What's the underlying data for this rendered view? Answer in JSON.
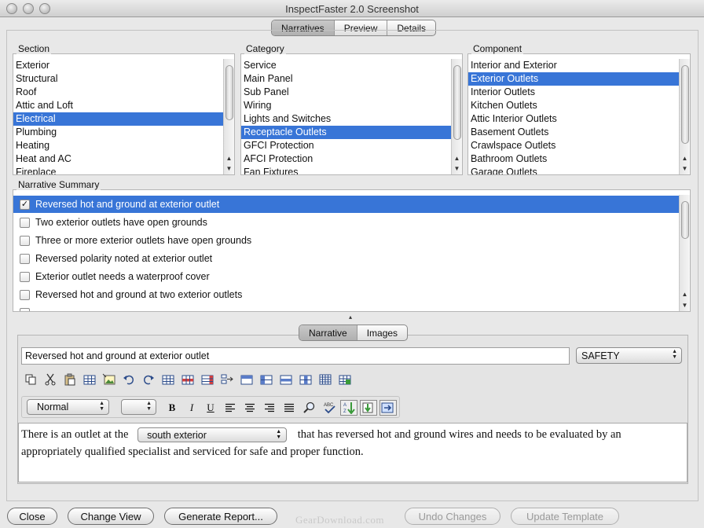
{
  "window": {
    "title": "InspectFaster 2.0 Screenshot"
  },
  "view_tabs": [
    {
      "label": "Narratives",
      "active": true
    },
    {
      "label": "Preview",
      "active": false
    },
    {
      "label": "Details",
      "active": false
    }
  ],
  "section": {
    "label": "Section",
    "items": [
      "Exterior",
      "Structural",
      "Roof",
      "Attic and Loft",
      "Electrical",
      "Plumbing",
      "Heating",
      "Heat and AC",
      "Fireplace"
    ],
    "selected": "Electrical"
  },
  "category": {
    "label": "Category",
    "items": [
      "Service",
      "Main Panel",
      "Sub Panel",
      "Wiring",
      "Lights and Switches",
      "Receptacle Outlets",
      "GFCI Protection",
      "AFCI Protection",
      "Fan Fixtures"
    ],
    "selected": "Receptacle Outlets"
  },
  "component": {
    "label": "Component",
    "items": [
      "Interior and Exterior",
      "Exterior Outlets",
      "Interior Outlets",
      "Kitchen Outlets",
      "Attic Interior Outlets",
      "Basement Outlets",
      "Crawlspace Outlets",
      "Bathroom Outlets",
      "Garage Outlets"
    ],
    "selected": "Exterior Outlets"
  },
  "narrative_summary": {
    "label": "Narrative Summary",
    "rows": [
      {
        "text": "Reversed hot and ground at exterior outlet",
        "checked": true,
        "selected": true
      },
      {
        "text": "Two exterior outlets have open grounds",
        "checked": false,
        "selected": false
      },
      {
        "text": "Three or more exterior outlets have open grounds",
        "checked": false,
        "selected": false
      },
      {
        "text": "Reversed polarity noted at exterior outlet",
        "checked": false,
        "selected": false
      },
      {
        "text": "Exterior outlet needs a waterproof cover",
        "checked": false,
        "selected": false
      },
      {
        "text": "Reversed hot and ground at two exterior outlets",
        "checked": false,
        "selected": false
      }
    ]
  },
  "editor_tabs": [
    {
      "label": "Narrative",
      "active": true
    },
    {
      "label": "Images",
      "active": false
    }
  ],
  "narrative_title": "Reversed hot and ground at exterior outlet",
  "severity": "SAFETY",
  "style_select": "Normal",
  "font_size_select": "",
  "toolbar_icons": [
    "copy-icon",
    "cut-icon",
    "paste-icon",
    "insert-table-icon",
    "insert-image-icon",
    "undo-icon",
    "redo-icon",
    "table-icon",
    "table-row-icon",
    "table-column-icon",
    "table-insert-icon",
    "table-header-icon",
    "table-split-icon",
    "table-merge-icon",
    "table-delete-icon",
    "table-grid-icon",
    "table-props-icon"
  ],
  "format_icons": [
    "bold-icon",
    "italic-icon",
    "underline-icon",
    "align-left-icon",
    "align-center-icon",
    "align-right-icon",
    "justify-icon",
    "find-icon",
    "spellcheck-icon",
    "sort-icon",
    "import-icon",
    "export-icon"
  ],
  "editor": {
    "text_before": "There is an outlet at the",
    "location_value": "south exterior",
    "text_after": "that has reversed hot and ground wires and needs to be evaluated by an appropriately qualified specialist and serviced for safe and proper function."
  },
  "buttons": {
    "close": "Close",
    "change_view": "Change View",
    "generate_report": "Generate Report...",
    "undo_changes": "Undo Changes",
    "update_template": "Update Template"
  },
  "watermark": "GearDownload.com",
  "colors": {
    "selection": "#3875d7",
    "window_bg": "#e8e8e8"
  }
}
